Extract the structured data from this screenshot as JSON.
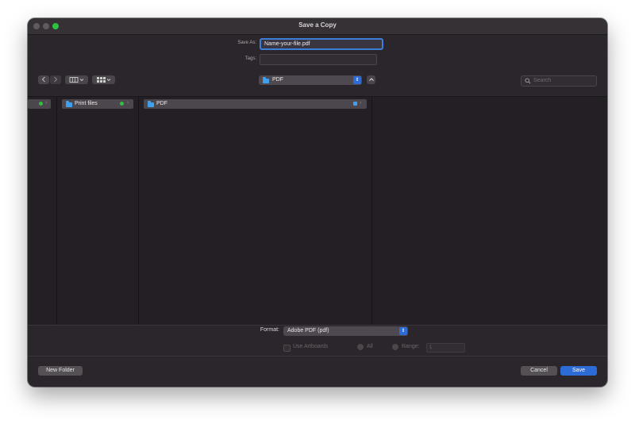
{
  "window": {
    "title": "Save a Copy"
  },
  "form": {
    "save_as_label": "Save As:",
    "save_as_value": "Name-your-file.pdf",
    "tags_label": "Tags:",
    "tags_value": ""
  },
  "toolbar": {
    "back_icon": "chevron-left-icon",
    "forward_icon": "chevron-right-icon",
    "view_columns_icon": "columns-view-icon",
    "view_grid_icon": "grid-view-icon",
    "location": "PDF",
    "search_placeholder": "Search"
  },
  "browser": {
    "columns": [
      {
        "items": [
          {
            "label": "",
            "selected": true
          }
        ]
      },
      {
        "items": [
          {
            "label": "Print files",
            "selected": true
          }
        ]
      },
      {
        "items": [
          {
            "label": "PDF",
            "selected": true
          }
        ]
      }
    ]
  },
  "options": {
    "format_label": "Format:",
    "format_value": "Adobe PDF (pdf)",
    "use_artboards_label": "Use Artboards",
    "all_label": "All",
    "range_label": "Range:",
    "range_value": "1"
  },
  "footer": {
    "new_folder_label": "New Folder",
    "cancel_label": "Cancel",
    "save_label": "Save"
  },
  "colors": {
    "accent": "#2d6bd6",
    "tag_green": "#2cc13f",
    "folder_blue": "#3fa0ef"
  }
}
